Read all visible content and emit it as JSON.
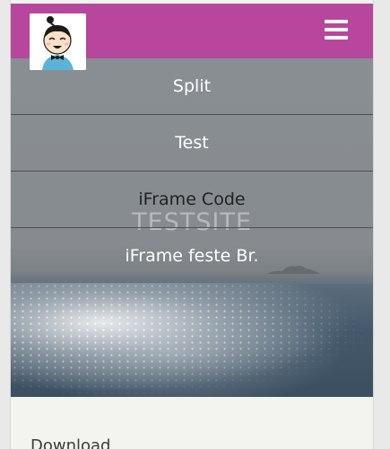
{
  "header": {
    "brand_color": "#b6479d",
    "logo_icon": "cartoon-boy-avatar-icon",
    "menu_icon": "hamburger-menu-icon"
  },
  "menu": {
    "items": [
      {
        "label": "Split"
      },
      {
        "label": "Test"
      },
      {
        "label": "iFrame Code"
      },
      {
        "label": "iFrame feste Br."
      }
    ]
  },
  "hero": {
    "site_title": "TESTSITE"
  },
  "content": {
    "download_label": "Download"
  }
}
